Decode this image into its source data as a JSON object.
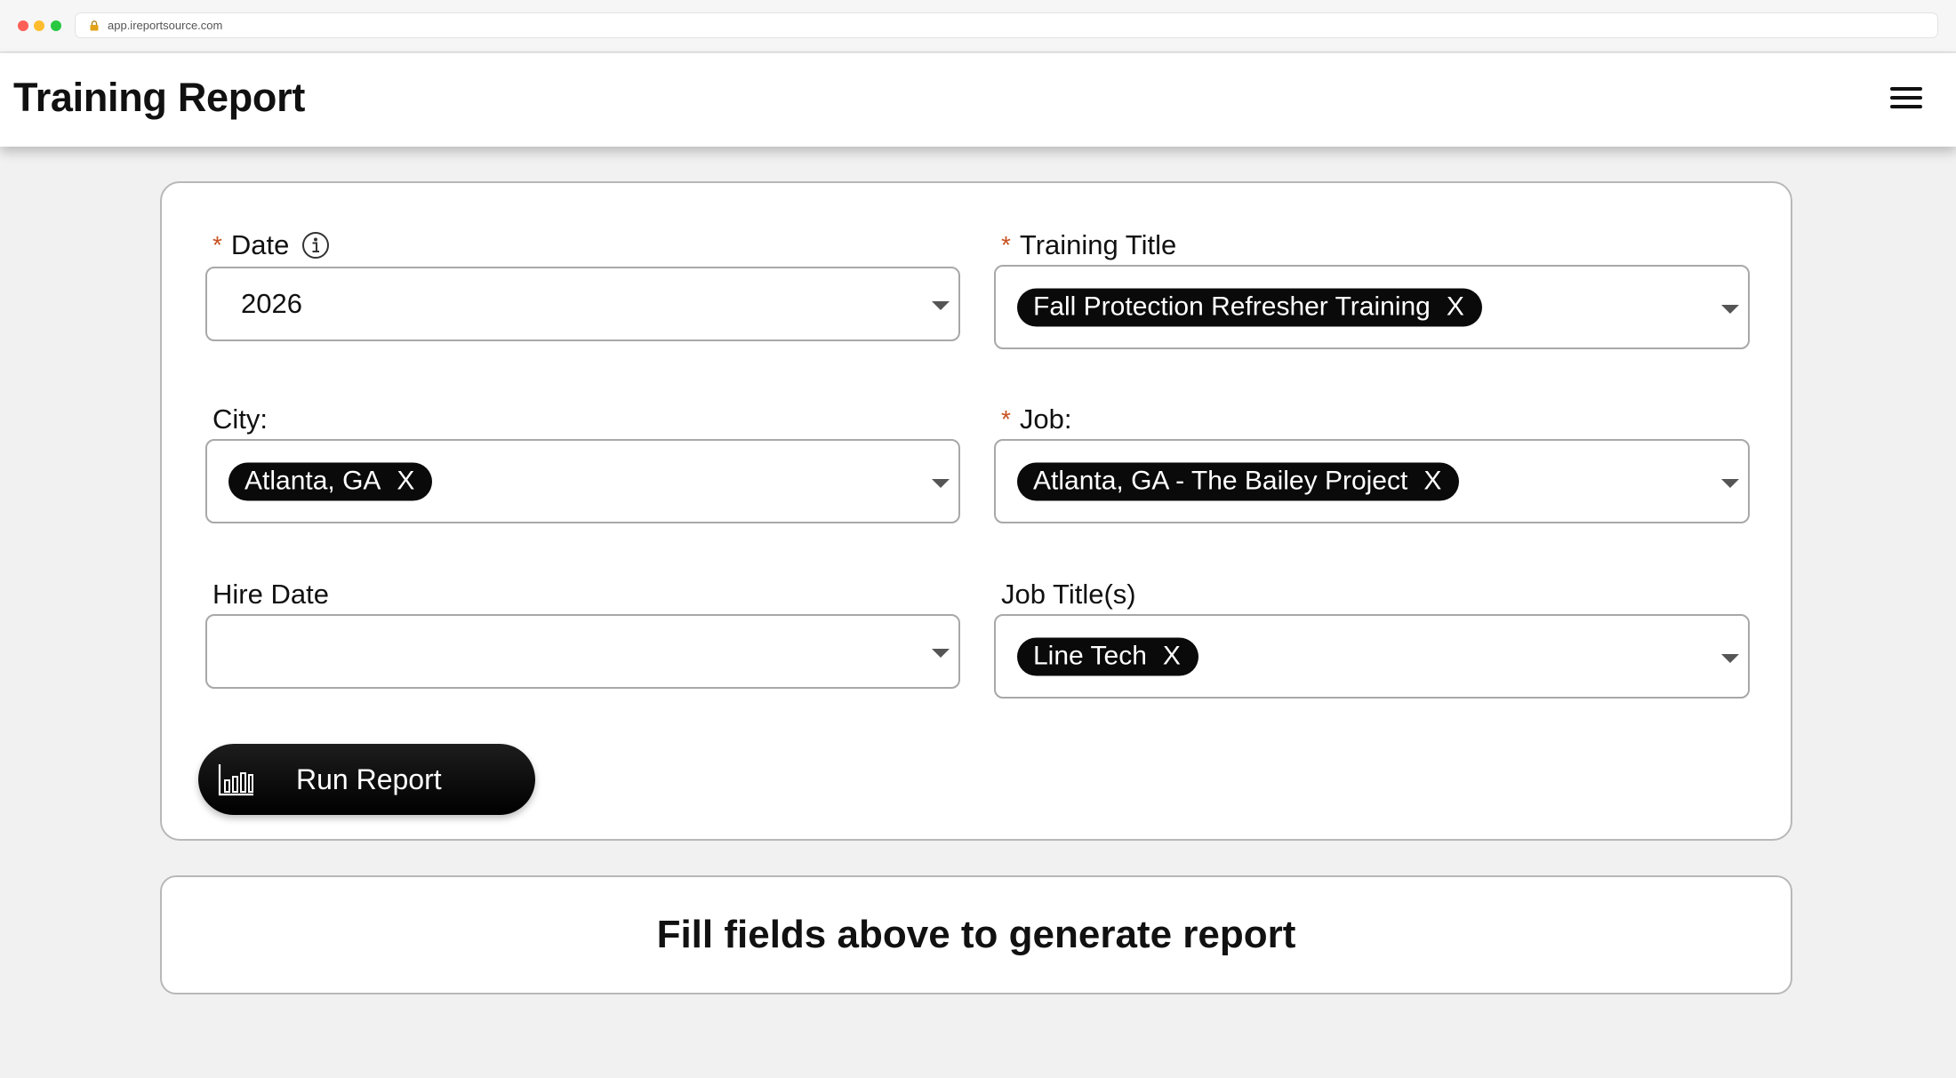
{
  "browser": {
    "url": "app.ireportsource.com"
  },
  "header": {
    "title": "Training Report",
    "menu_icon": "hamburger-menu-icon"
  },
  "form": {
    "date": {
      "required_mark": "*",
      "label": "Date",
      "value": "2026",
      "info_icon": "info-icon"
    },
    "training_title": {
      "required_mark": "*",
      "label": "Training Title",
      "chip": "Fall Protection Refresher Training",
      "remove": "X"
    },
    "city": {
      "label": "City:",
      "chip": "Atlanta, GA",
      "remove": "X"
    },
    "job": {
      "required_mark": "*",
      "label": "Job:",
      "chip": "Atlanta, GA - The Bailey Project",
      "remove": "X"
    },
    "hire_date": {
      "label": "Hire Date",
      "value": ""
    },
    "job_titles": {
      "label": "Job Title(s)",
      "chip": "Line Tech",
      "remove": "X"
    },
    "run_button": {
      "label": "Run Report",
      "icon": "bar-chart-icon"
    }
  },
  "message": {
    "text": "Fill fields above to generate report"
  },
  "colors": {
    "accent": "#000000",
    "required": "#c8501e",
    "background": "#f1f1f1"
  }
}
